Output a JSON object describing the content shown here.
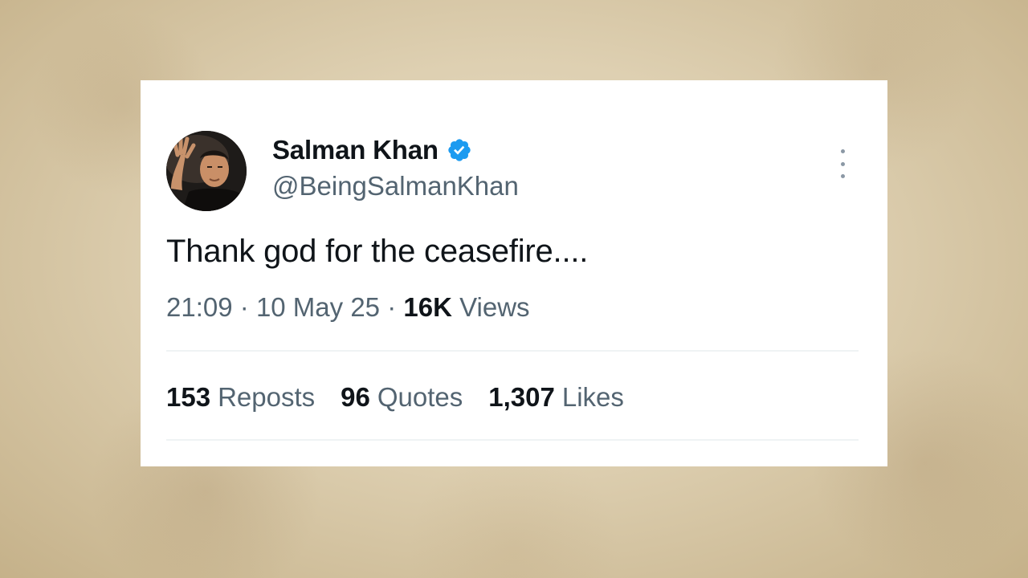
{
  "tweet": {
    "display_name": "Salman Khan",
    "handle": "@BeingSalmanKhan",
    "verified": true,
    "verified_color": "#1d9bf0",
    "text": "Thank god for the ceasefire....",
    "time": "21:09",
    "date": "10 May 25",
    "separator": "·",
    "views_count": "16K",
    "views_label": "Views",
    "stats": [
      {
        "count": "153",
        "label": "Reposts"
      },
      {
        "count": "96",
        "label": "Quotes"
      },
      {
        "count": "1,307",
        "label": "Likes"
      }
    ],
    "icons": {
      "avatar": "profile-photo",
      "verified": "verified-badge-icon",
      "more": "more-vertical-icon"
    }
  }
}
